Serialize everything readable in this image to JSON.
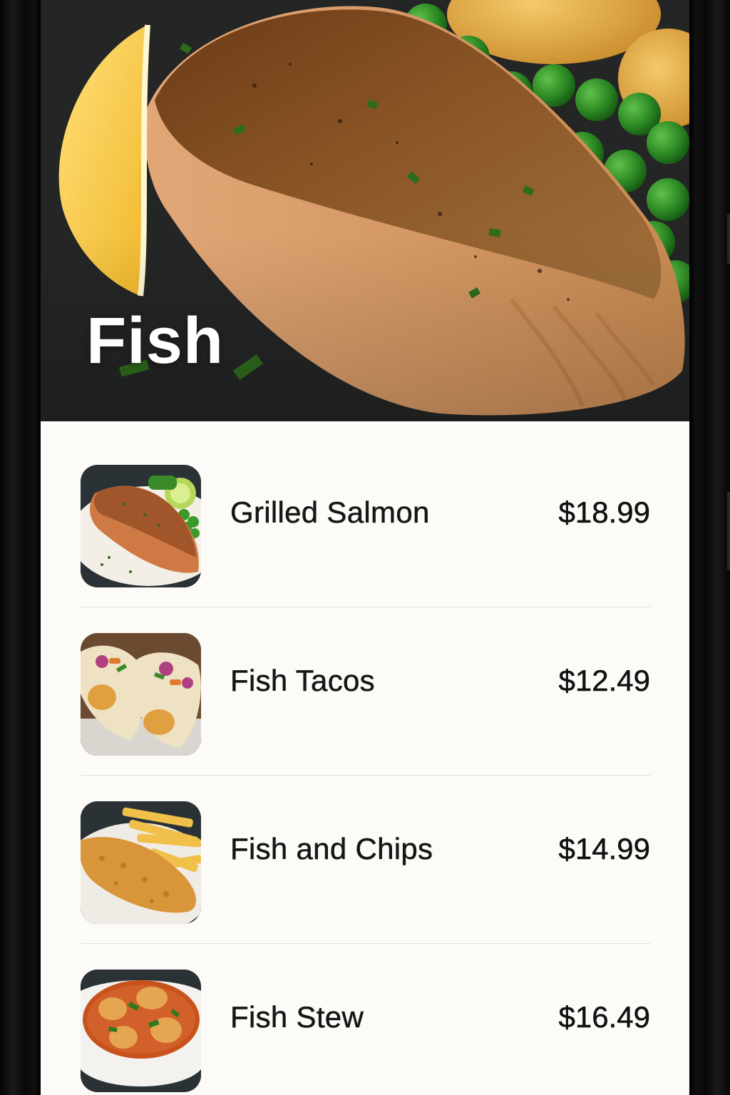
{
  "category": {
    "title": "Fish",
    "hero_image": "grilled-fish-fillet-with-lemon-and-peas"
  },
  "menu": {
    "items": [
      {
        "name": "Grilled Salmon",
        "price": "$18.99",
        "image": "grilled-salmon-plate"
      },
      {
        "name": "Fish Tacos",
        "price": "$12.49",
        "image": "fish-tacos"
      },
      {
        "name": "Fish and Chips",
        "price": "$14.99",
        "image": "fish-and-chips"
      },
      {
        "name": "Fish Stew",
        "price": "$16.49",
        "image": "fish-stew-bowl"
      }
    ]
  },
  "colors": {
    "screen_background": "#fcfbf8",
    "text": "#161616",
    "divider": "#e2ded7",
    "hero_title": "#ffffff"
  }
}
